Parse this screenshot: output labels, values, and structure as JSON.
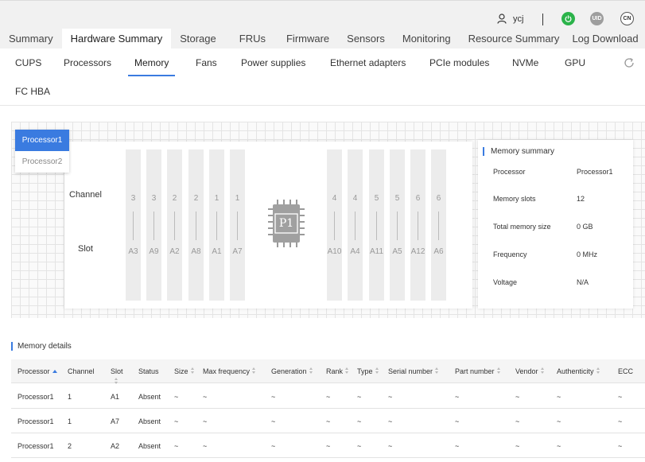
{
  "header": {
    "username": "ycj",
    "power_badge": "",
    "uid_badge": "UID",
    "lang_badge": "CN"
  },
  "main_tabs": [
    {
      "label": "Summary"
    },
    {
      "label": "Hardware Summary"
    },
    {
      "label": "Storage"
    },
    {
      "label": "FRUs"
    },
    {
      "label": "Firmware"
    },
    {
      "label": "Sensors"
    },
    {
      "label": "Monitoring"
    },
    {
      "label": "Resource Summary"
    },
    {
      "label": "Log Download"
    }
  ],
  "sub_tabs": [
    {
      "label": "CUPS"
    },
    {
      "label": "Processors"
    },
    {
      "label": "Memory"
    },
    {
      "label": "Fans"
    },
    {
      "label": "Power supplies"
    },
    {
      "label": "Ethernet adapters"
    },
    {
      "label": "PCIe modules"
    },
    {
      "label": "NVMe"
    },
    {
      "label": "GPU"
    },
    {
      "label": "FC HBA"
    }
  ],
  "processor_selector": [
    "Processor1",
    "Processor2"
  ],
  "diagram": {
    "channel_label": "Channel",
    "slot_label": "Slot",
    "chip_label": "P1",
    "left_slots": [
      {
        "channel": "3",
        "slot": "A3"
      },
      {
        "channel": "3",
        "slot": "A9"
      },
      {
        "channel": "2",
        "slot": "A2"
      },
      {
        "channel": "2",
        "slot": "A8"
      },
      {
        "channel": "1",
        "slot": "A1"
      },
      {
        "channel": "1",
        "slot": "A7"
      }
    ],
    "right_slots": [
      {
        "channel": "4",
        "slot": "A10"
      },
      {
        "channel": "4",
        "slot": "A4"
      },
      {
        "channel": "5",
        "slot": "A11"
      },
      {
        "channel": "5",
        "slot": "A5"
      },
      {
        "channel": "6",
        "slot": "A12"
      },
      {
        "channel": "6",
        "slot": "A6"
      }
    ]
  },
  "memory_summary": {
    "title": "Memory summary",
    "rows": [
      {
        "key": "Processor",
        "value": "Processor1"
      },
      {
        "key": "Memory slots",
        "value": "12"
      },
      {
        "key": "Total memory size",
        "value": "0 GB"
      },
      {
        "key": "Frequency",
        "value": "0 MHz"
      },
      {
        "key": "Voltage",
        "value": "N/A"
      }
    ]
  },
  "memory_details": {
    "title": "Memory details",
    "columns": [
      "Processor",
      "Channel",
      "Slot",
      "Status",
      "Size",
      "Max frequency",
      "Generation",
      "Rank",
      "Type",
      "Serial number",
      "Part number",
      "Vendor",
      "Authenticity",
      "ECC"
    ],
    "rows": [
      [
        "Processor1",
        "1",
        "A1",
        "Absent",
        "~",
        "~",
        "~",
        "~",
        "~",
        "~",
        "~",
        "~",
        "~",
        "~"
      ],
      [
        "Processor1",
        "1",
        "A7",
        "Absent",
        "~",
        "~",
        "~",
        "~",
        "~",
        "~",
        "~",
        "~",
        "~",
        "~"
      ],
      [
        "Processor1",
        "2",
        "A2",
        "Absent",
        "~",
        "~",
        "~",
        "~",
        "~",
        "~",
        "~",
        "~",
        "~",
        "~"
      ]
    ]
  },
  "colors": {
    "accent": "#3a7be0",
    "power_green": "#2bb34a"
  }
}
